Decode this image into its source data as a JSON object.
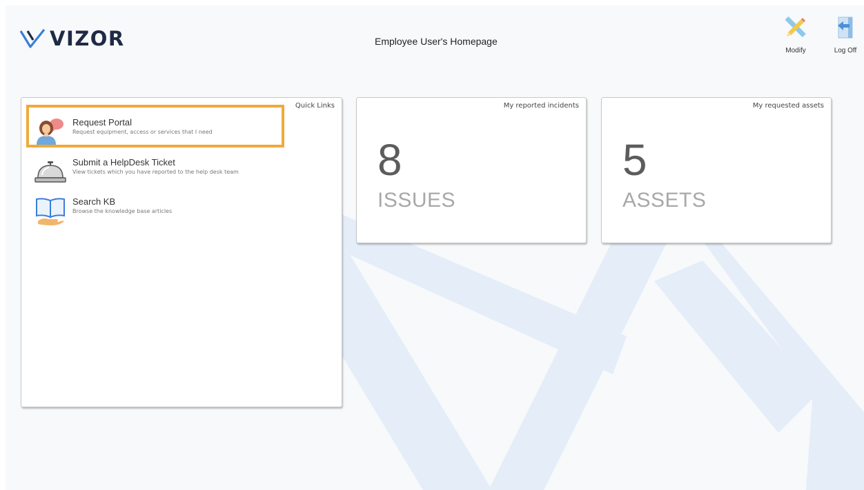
{
  "header": {
    "brand": "VIZOR",
    "page_title": "Employee User's Homepage",
    "tools": [
      {
        "label": "Modify",
        "icon": "pencil-ruler-icon"
      },
      {
        "label": "Log Off",
        "icon": "logoff-arrow-icon"
      }
    ]
  },
  "quick_links": {
    "title": "Quick Links",
    "items": [
      {
        "label": "Request Portal",
        "description": "Request equipment, access or services that I need",
        "icon": "person-speech-icon",
        "highlighted": true
      },
      {
        "label": "Submit a HelpDesk Ticket",
        "description": "View tickets which you have reported to the help desk team",
        "icon": "service-bell-icon",
        "highlighted": false
      },
      {
        "label": "Search KB",
        "description": "Browse the knowledge base articles",
        "icon": "book-hand-icon",
        "highlighted": false
      }
    ]
  },
  "incidents_panel": {
    "title": "My reported incidents",
    "count": "8",
    "unit": "ISSUES"
  },
  "assets_panel": {
    "title": "My requested assets",
    "count": "5",
    "unit": "ASSETS"
  },
  "colors": {
    "highlight": "#f0a93a",
    "brand_dark": "#1f2a44",
    "brand_blue": "#3b7dd8",
    "background_art": "#e3edf8"
  }
}
